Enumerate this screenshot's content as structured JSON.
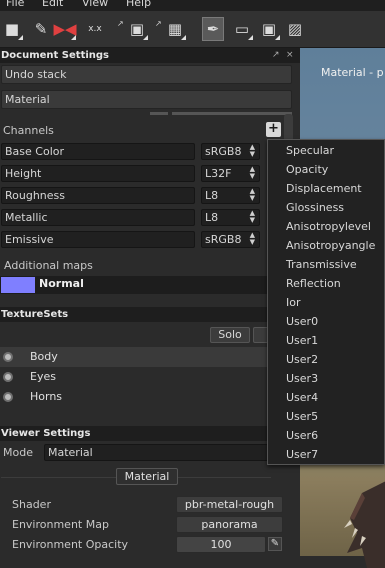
{
  "menubar": {
    "items": [
      "File",
      "Edit",
      "View",
      "Help"
    ]
  },
  "toolbar": {
    "icons": [
      "brush-mask-icon",
      "eyedropper-icon",
      "symmetry-icon",
      "xx-icon",
      "camera-icon",
      "texture-grid-icon",
      "paint-brush-icon",
      "eraser-icon",
      "image-icon",
      "projection-icon"
    ]
  },
  "document_settings": {
    "title": "Document Settings",
    "undo_stack": "Undo stack",
    "material": "Material",
    "channels_label": "Channels",
    "plus_label": "+",
    "channels": [
      {
        "name": "Base Color",
        "format": "sRGB8"
      },
      {
        "name": "Height",
        "format": "L32F"
      },
      {
        "name": "Roughness",
        "format": "L8"
      },
      {
        "name": "Metallic",
        "format": "L8"
      },
      {
        "name": "Emissive",
        "format": "sRGB8"
      }
    ],
    "additional_maps_label": "Additional maps",
    "normal_label": "Normal"
  },
  "texture_sets": {
    "title": "TextureSets",
    "solo_label": "Solo",
    "items": [
      "Body",
      "Eyes",
      "Horns"
    ]
  },
  "viewer_settings": {
    "title": "Viewer Settings",
    "mode_label": "Mode",
    "mode_value": "Material",
    "material_tab": "Material",
    "shader_label": "Shader",
    "shader_value": "pbr-metal-rough",
    "env_map_label": "Environment Map",
    "env_map_value": "panorama",
    "env_opacity_label": "Environment Opacity",
    "env_opacity_value": "100"
  },
  "viewport": {
    "title": "Material - p"
  },
  "dropdown": {
    "items": [
      "Specular",
      "Opacity",
      "Displacement",
      "Glossiness",
      "Anisotropylevel",
      "Anisotropyangle",
      "Transmissive",
      "Reflection",
      "Ior",
      "User0",
      "User1",
      "User2",
      "User3",
      "User4",
      "User5",
      "User6",
      "User7"
    ]
  },
  "colors": {
    "normal_swatch": "#7f7fff",
    "panel_bg": "#2b2b2b",
    "header_bg": "#1e1e1e"
  }
}
